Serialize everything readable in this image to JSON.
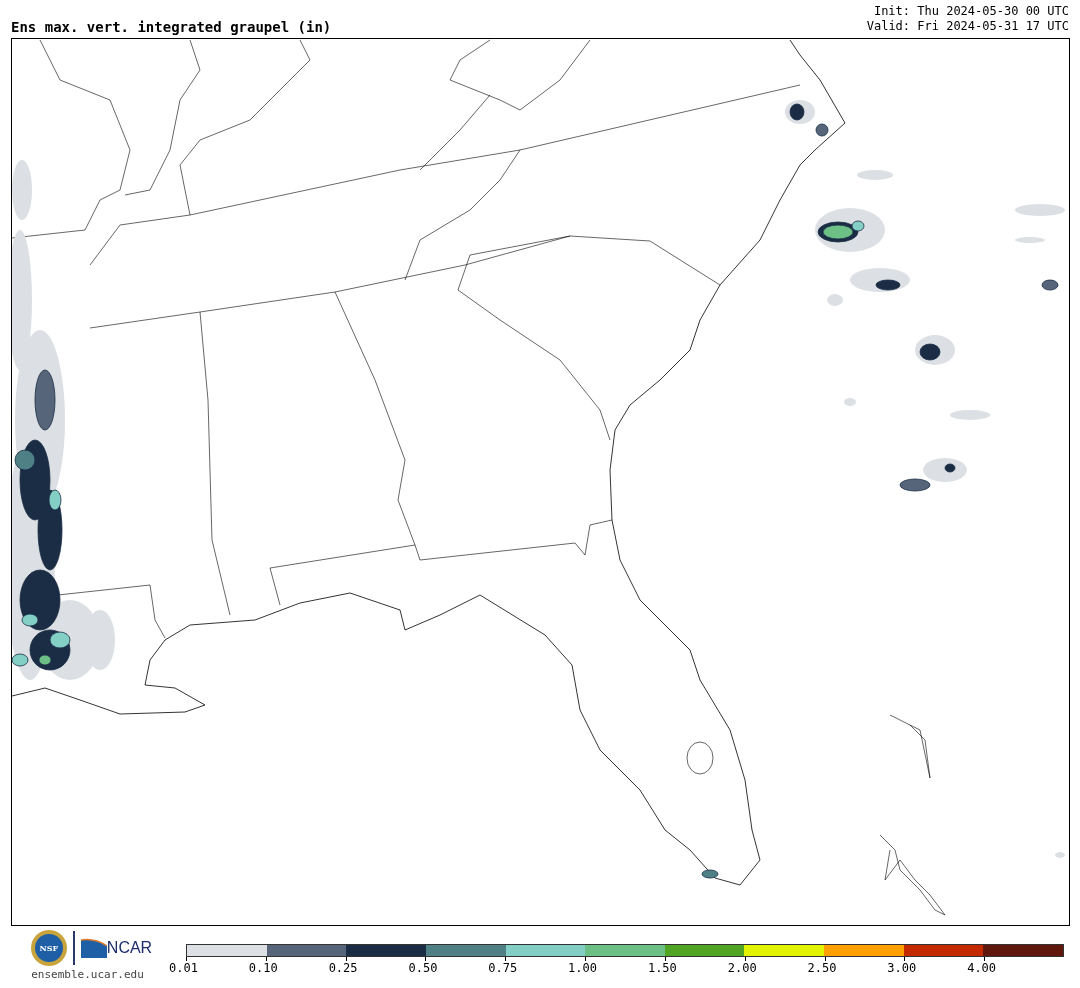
{
  "title": "Ens max. vert. integrated graupel (in)",
  "init": "Init: Thu 2024-05-30 00 UTC",
  "valid": "Valid: Fri 2024-05-31 17 UTC",
  "logos": {
    "seal": "NSF",
    "org": "NCAR",
    "site": "ensemble.ucar.edu"
  },
  "colorbar": [
    {
      "label": "0.01",
      "color": "#dce0e4"
    },
    {
      "label": "0.10",
      "color": "#56657a"
    },
    {
      "label": "0.25",
      "color": "#1b2d45"
    },
    {
      "label": "0.50",
      "color": "#4e8085"
    },
    {
      "label": "0.75",
      "color": "#83cfc6"
    },
    {
      "label": "1.00",
      "color": "#6cc086"
    },
    {
      "label": "1.50",
      "color": "#52a425"
    },
    {
      "label": "2.00",
      "color": "#e3f400"
    },
    {
      "label": "2.50",
      "color": "#ffa000"
    },
    {
      "label": "3.00",
      "color": "#c42a00"
    },
    {
      "label": "4.00",
      "color": "#61180c"
    }
  ]
}
